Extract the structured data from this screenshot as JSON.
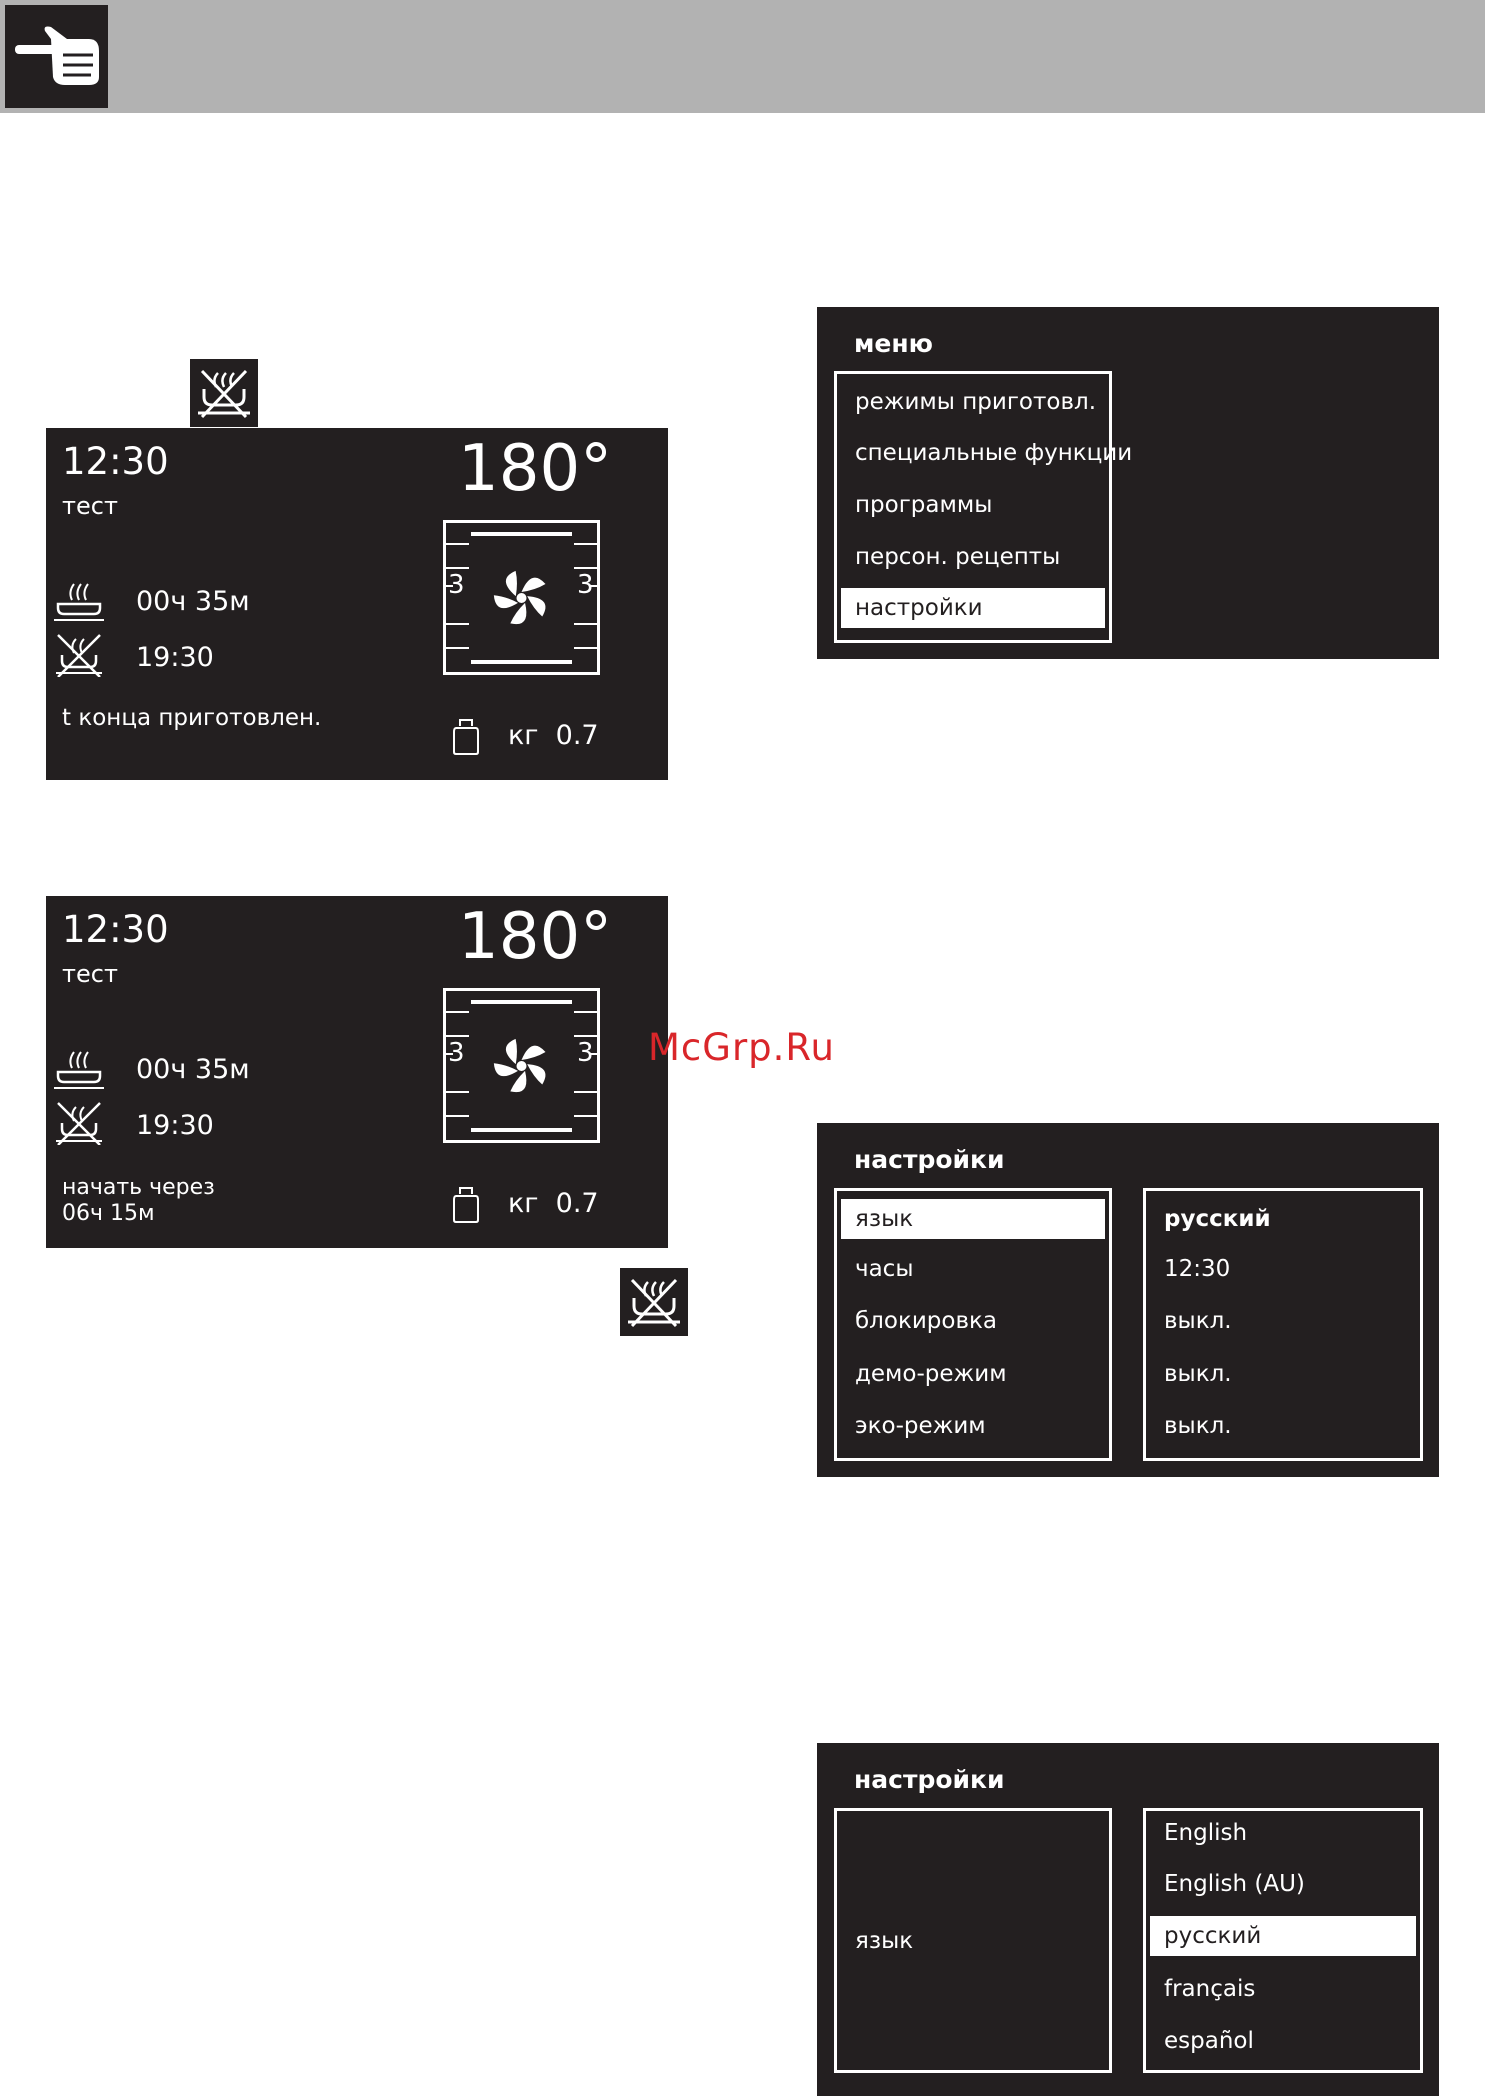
{
  "panel1": {
    "clock": "12:30",
    "name": "тест",
    "temperature": "180°",
    "shelf_level_left": "3",
    "shelf_level_right": "3",
    "duration": "00ч 35м",
    "end_time": "19:30",
    "status": "t конца приготовлен.",
    "weight_unit": "кг",
    "weight_value": "0.7"
  },
  "panel2": {
    "clock": "12:30",
    "name": "тест",
    "temperature": "180°",
    "shelf_level_left": "3",
    "shelf_level_right": "3",
    "duration": "00ч 35м",
    "end_time": "19:30",
    "status_line1": "начать через",
    "status_line2": "06ч 15м",
    "weight_unit": "кг",
    "weight_value": "0.7"
  },
  "menu": {
    "title": "меню",
    "items": [
      "режимы приготовл.",
      "специальные функции",
      "программы",
      "персон. рецепты",
      "настройки"
    ],
    "selected_index": 4
  },
  "settings": {
    "title": "настройки",
    "items": [
      "язык",
      "часы",
      "блокировка",
      "демо-режим",
      "эко-режим"
    ],
    "values": [
      "русский",
      "12:30",
      "выкл.",
      "выкл.",
      "выкл."
    ],
    "selected_index": 0
  },
  "language": {
    "title": "настройки",
    "label": "язык",
    "options": [
      "English",
      "English (AU)",
      "русский",
      "français",
      "español"
    ],
    "selected_index": 2
  },
  "watermark": "McGrp.Ru",
  "colors": {
    "panel": "#231f20",
    "header": "#b2b2b2",
    "watermark": "#d9262a"
  },
  "icons": [
    "pointing-hand-icon",
    "no-preheat-icon",
    "steam-pan-icon",
    "crossed-dish-icon",
    "fan-icon",
    "weight-icon"
  ]
}
